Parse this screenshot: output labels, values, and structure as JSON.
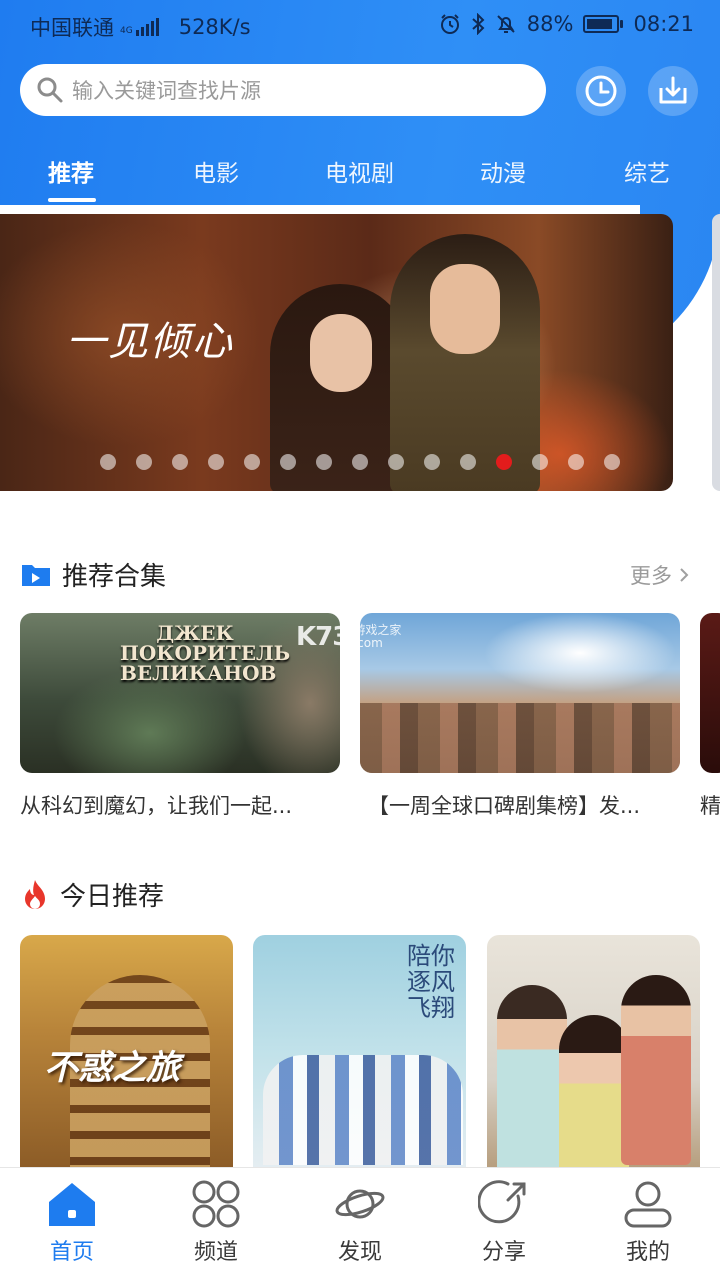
{
  "status_bar": {
    "carrier": "中国联通",
    "network_tag": "4G",
    "speed": "528K/s",
    "battery": "88%",
    "time": "08:21"
  },
  "search": {
    "placeholder": "输入关键词查找片源",
    "history_icon": "clock-icon",
    "download_icon": "download-icon"
  },
  "tabs": [
    {
      "label": "推荐",
      "active": true
    },
    {
      "label": "电影",
      "active": false
    },
    {
      "label": "电视剧",
      "active": false
    },
    {
      "label": "动漫",
      "active": false
    },
    {
      "label": "综艺",
      "active": false
    }
  ],
  "banner": {
    "title": "一见倾心",
    "dot_count": 15,
    "active_dot": 12
  },
  "collections": {
    "title": "推荐合集",
    "more": "更多",
    "items": [
      {
        "poster_title": "ДЖЕК ПОКОРИТЕЛЬ ВЕЛИКАНОВ",
        "caption": "从科幻到魔幻，让我们一起..."
      },
      {
        "caption": "【一周全球口碑剧集榜】发..."
      },
      {
        "caption": "精"
      }
    ],
    "watermark_main": "K73",
    "watermark_sub1": "游戏之家",
    "watermark_sub2": ".com"
  },
  "today": {
    "title": "今日推荐",
    "posters": [
      {
        "title": "不惑之旅"
      },
      {
        "title": "陪你逐风飞翔"
      },
      {
        "title": ""
      }
    ]
  },
  "bottom_nav": [
    {
      "label": "首页",
      "icon": "home-icon",
      "active": true
    },
    {
      "label": "频道",
      "icon": "grid-icon",
      "active": false
    },
    {
      "label": "发现",
      "icon": "planet-icon",
      "active": false
    },
    {
      "label": "分享",
      "icon": "share-icon",
      "active": false
    },
    {
      "label": "我的",
      "icon": "user-icon",
      "active": false
    }
  ],
  "colors": {
    "primary": "#1e7cef",
    "active_dot": "#e21c1c",
    "fire": "#e8362b"
  }
}
